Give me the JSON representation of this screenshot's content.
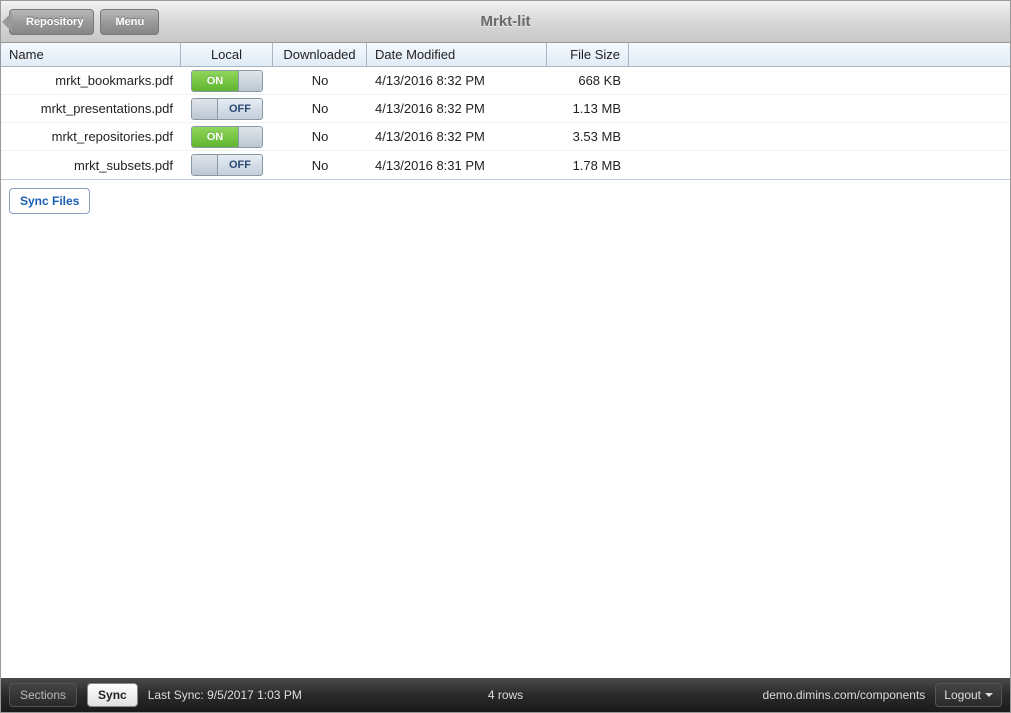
{
  "header": {
    "back_label": "Repository",
    "menu_label": "Menu",
    "title": "Mrkt-lit"
  },
  "table": {
    "columns": {
      "name": "Name",
      "local": "Local",
      "downloaded": "Downloaded",
      "date_modified": "Date Modified",
      "file_size": "File Size"
    },
    "toggle_labels": {
      "on": "ON",
      "off": "OFF"
    },
    "rows": [
      {
        "name": "mrkt_bookmarks.pdf",
        "local": true,
        "downloaded": "No",
        "date_modified": "4/13/2016 8:32 PM",
        "file_size": "668 KB"
      },
      {
        "name": "mrkt_presentations.pdf",
        "local": false,
        "downloaded": "No",
        "date_modified": "4/13/2016 8:32 PM",
        "file_size": "1.13 MB"
      },
      {
        "name": "mrkt_repositories.pdf",
        "local": true,
        "downloaded": "No",
        "date_modified": "4/13/2016 8:32 PM",
        "file_size": "3.53 MB"
      },
      {
        "name": "mrkt_subsets.pdf",
        "local": false,
        "downloaded": "No",
        "date_modified": "4/13/2016 8:31 PM",
        "file_size": "1.78 MB"
      }
    ]
  },
  "actions": {
    "sync_files": "Sync Files"
  },
  "footer": {
    "sections": "Sections",
    "sync": "Sync",
    "last_sync": "Last Sync: 9/5/2017 1:03 PM",
    "row_count": "4 rows",
    "domain": "demo.dimins.com/components",
    "logout": "Logout"
  }
}
